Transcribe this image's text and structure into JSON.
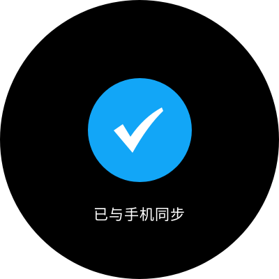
{
  "screen": {
    "background_color": "#000000"
  },
  "status": {
    "icon": "checkmark-icon",
    "badge_color": "#12a6f7",
    "message": "已与手机同步"
  }
}
